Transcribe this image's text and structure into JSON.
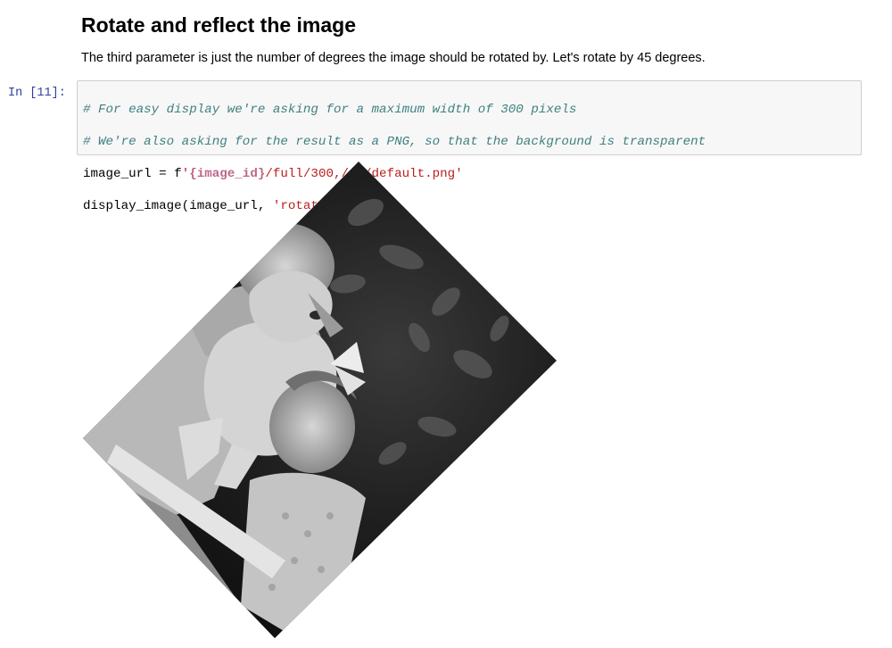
{
  "markdown": {
    "heading": "Rotate and reflect the image",
    "paragraph": "The third parameter is just the number of degrees the image should be rotated by. Let's rotate by 45 degrees."
  },
  "cell": {
    "prompt": "In [11]:",
    "line1_comment": "# For easy display we're asking for a maximum width of 300 pixels",
    "line2_comment": "# We're also asking for the result as a PNG, so that the background is transparent",
    "line3_prefix": "image_url = f",
    "line3_str_open": "'",
    "line3_interp": "{image_id}",
    "line3_str_rest": "/full/300,/45/default.png'",
    "line4_prefix": "display_image(image_url, ",
    "line4_str": "'rotate'",
    "line4_suffix": ")"
  },
  "output": {
    "image_alt": "rotated black and white photo of two children holding a dog",
    "rotation_degrees": 45
  },
  "colors": {
    "prompt": "#303f9f",
    "comment": "#408080",
    "string": "#ba2121",
    "interpolation": "#bb6688",
    "cell_bg": "#f7f7f7",
    "cell_border": "#cfcfcf"
  }
}
